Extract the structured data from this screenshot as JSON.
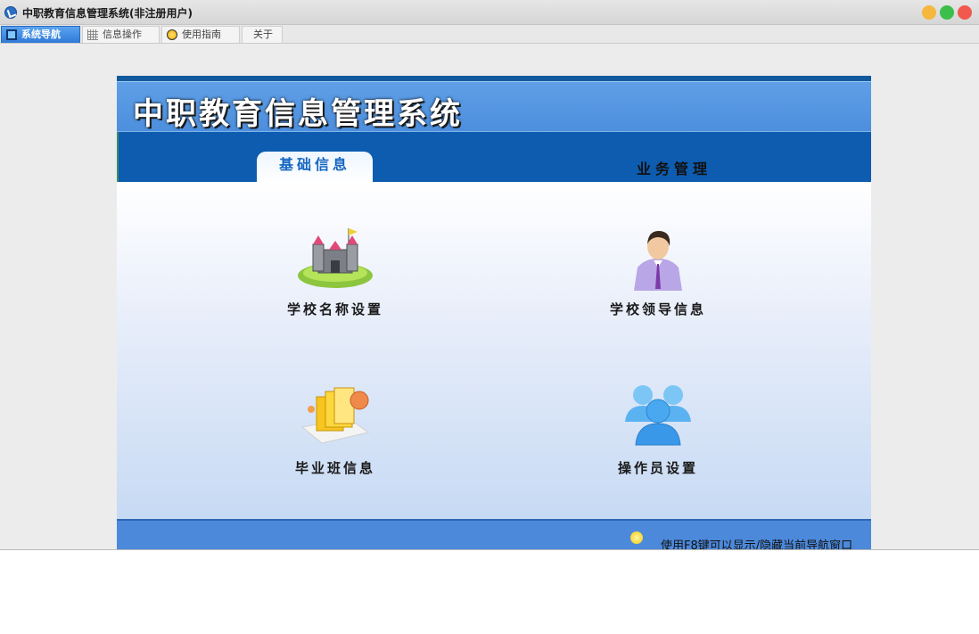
{
  "window": {
    "title": "中职教育信息管理系统(非注册用户)"
  },
  "tabs": [
    {
      "label": "系统导航",
      "icon": "monitor-icon"
    },
    {
      "label": "信息操作",
      "icon": "grid-icon"
    },
    {
      "label": "使用指南",
      "icon": "lightbulb-icon"
    },
    {
      "label": "关于"
    }
  ],
  "header": {
    "title": "中职教育信息管理系统"
  },
  "nav": {
    "active": "基础信息",
    "other": "业务管理"
  },
  "items": [
    {
      "label": "学校名称设置",
      "icon": "castle-icon"
    },
    {
      "label": "学校领导信息",
      "icon": "leader-icon"
    },
    {
      "label": "毕业班信息",
      "icon": "folders-icon"
    },
    {
      "label": "操作员设置",
      "icon": "users-icon"
    }
  ],
  "footer": {
    "tip": "使用F8键可以显示/隐藏当前导航窗口"
  },
  "colors": {
    "header": "#5592e2",
    "navbar": "#0d5cb0",
    "footer": "#4c89db",
    "active_tab": "#2f7ad8"
  }
}
